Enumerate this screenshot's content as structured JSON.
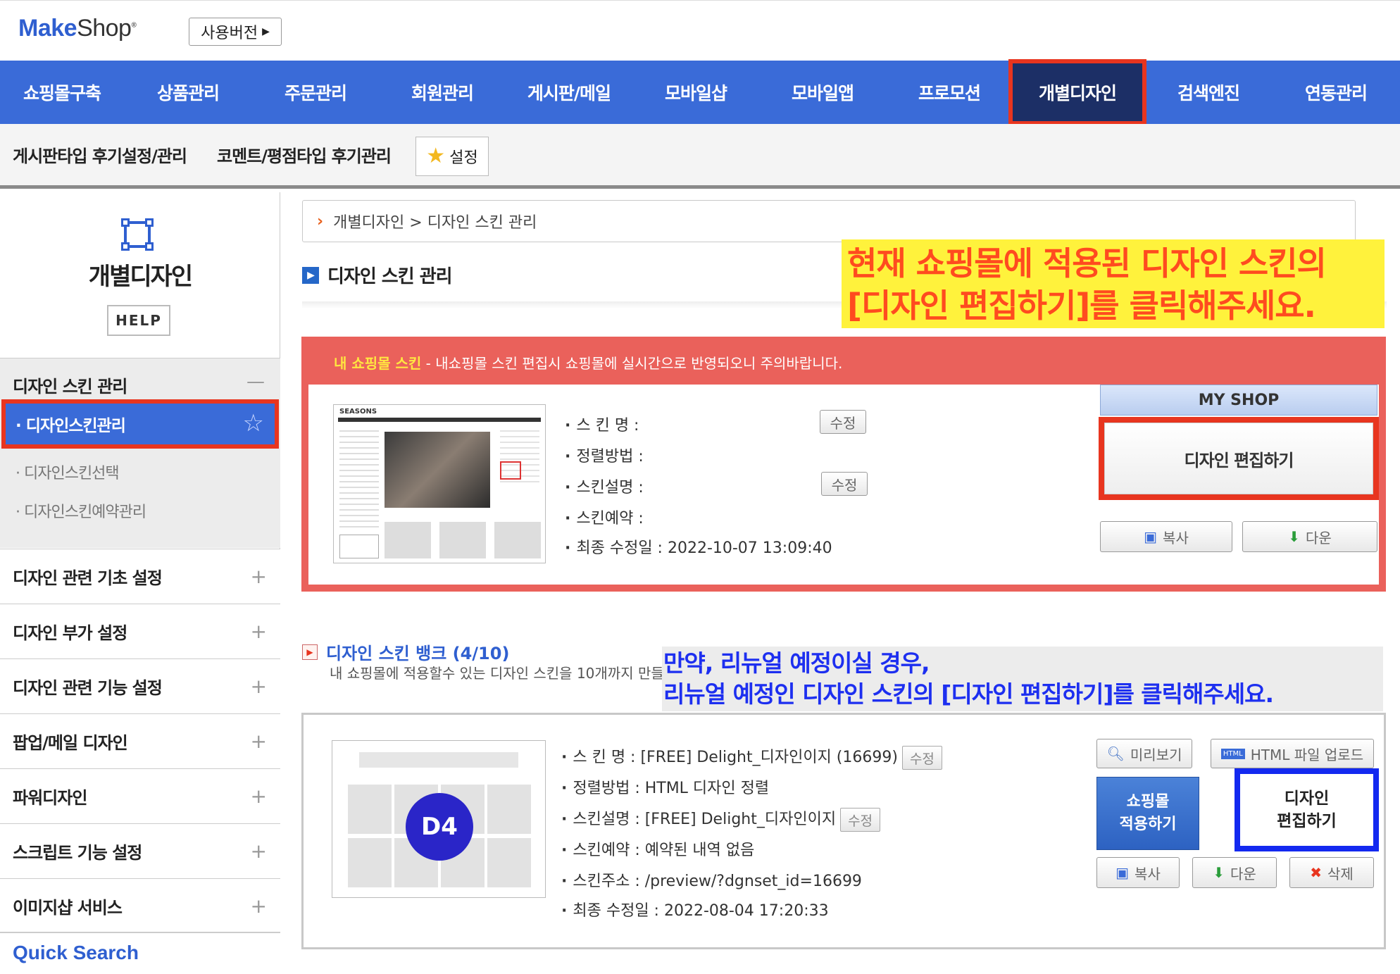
{
  "header": {
    "logo_make": "Make",
    "logo_shop": "Shop",
    "logo_mark": "®",
    "version_button": "사용버전"
  },
  "main_nav": [
    {
      "label": "쇼핑몰구축"
    },
    {
      "label": "상품관리"
    },
    {
      "label": "주문관리"
    },
    {
      "label": "회원관리"
    },
    {
      "label": "게시판/메일"
    },
    {
      "label": "모바일샵"
    },
    {
      "label": "모바일앱"
    },
    {
      "label": "프로모션"
    },
    {
      "label": "개별디자인",
      "active": true
    },
    {
      "label": "검색엔진"
    },
    {
      "label": "연동관리"
    }
  ],
  "sub_nav": {
    "item1": "게시판타입 후기설정/관리",
    "item2": "코멘트/평점타입 후기관리",
    "settings": "설정"
  },
  "sidebar": {
    "title": "개별디자인",
    "help": "HELP",
    "group_title": "디자인 스킨 관리",
    "active_item": "· 디자인스킨관리",
    "sub_items": [
      "· 디자인스킨선택",
      "· 디자인스킨예약관리"
    ],
    "sections": [
      "디자인 관련 기초 설정",
      "디자인 부가 설정",
      "디자인 관련 기능 설정",
      "팝업/메일 디자인",
      "파워디자인",
      "스크립트 기능 설정",
      "이미지샵 서비스"
    ],
    "quick_search": "Quick Search"
  },
  "breadcrumb": "개별디자인 > 디자인 스킨 관리",
  "page_title": "디자인 스킨 관리",
  "callout1": {
    "line1": "현재 쇼핑몰에 적용된 디자인 스킨의",
    "line2": "[디자인 편집하기]를 클릭해주세요."
  },
  "my_skin": {
    "header_label": "내 쇼핑몰 스킨",
    "header_note": " - 내쇼핑몰 스킨 편집시 쇼핑몰에 실시간으로 반영되오니 주의바랍니다.",
    "thumb_brand": "SEASONS",
    "name": "스 킨 명 :",
    "sort": "정렬방법 :",
    "desc": "스킨설명 :",
    "reserve": "스킨예약 :",
    "modified": "최종 수정일 : 2022-10-07 13:09:40",
    "edit_small": "수정",
    "myshop_label": "MY SHOP",
    "edit_design": "디자인 편집하기",
    "copy": "복사",
    "download": "다운"
  },
  "bank": {
    "title": "디자인 스킨 뱅크 (4/10)",
    "desc": "내 쇼핑몰에 적용할수 있는 디자인 스킨을 10개까지 만들",
    "callout_line1": "만약, 리뉴얼 예정이실 경우,",
    "callout_line2": "리뉴얼 예정인 디자인 스킨의 [디자인 편집하기]를 클릭해주세요.",
    "thumb_label": "D4",
    "name": "스 킨 명 : [FREE] Delight_디자인이지 (16699)",
    "sort": "정렬방법 : HTML 디자인 정렬",
    "desc_line": "스킨설명 : [FREE] Delight_디자인이지",
    "reserve": "스킨예약 : 예약된 내역 없음",
    "address": "스킨주소 : /preview/?dgnset_id=16699",
    "modified": "최종 수정일 : 2022-08-04 17:20:33",
    "edit_small": "수정",
    "preview": "미리보기",
    "html_upload": "HTML 파일 업로드",
    "apply_line1": "쇼핑몰",
    "apply_line2": "적용하기",
    "edit_line1": "디자인",
    "edit_line2": "편집하기",
    "copy": "복사",
    "download": "다운",
    "delete": "삭제"
  }
}
